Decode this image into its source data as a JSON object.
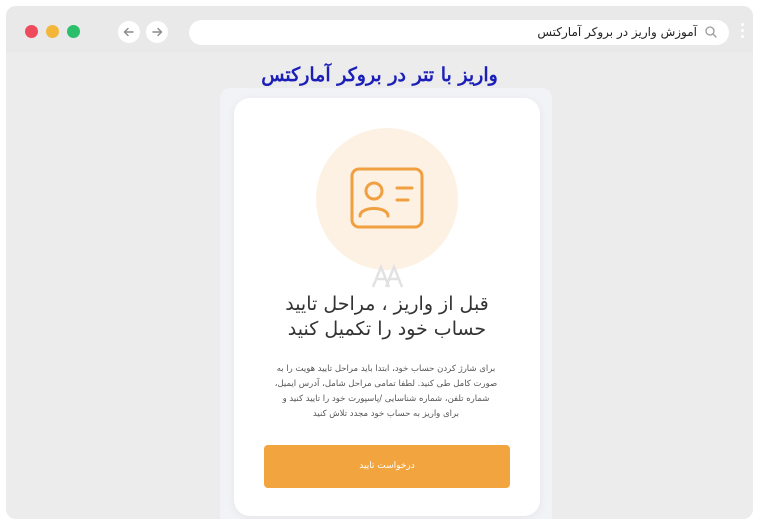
{
  "browser": {
    "address_text": "آموزش واریز در بروکر آمارکتس",
    "icons": {
      "back": "arrow-left-icon",
      "forward": "arrow-right-icon",
      "search": "search-icon",
      "menu": "more-vertical-icon"
    },
    "traffic_lights": [
      "#ee4b5d",
      "#f4b63a",
      "#2bbf6c"
    ]
  },
  "page": {
    "heading": "واریز با تتر در بروکر آمارکتس"
  },
  "card": {
    "icon": "id-card-icon",
    "accent_color": "#f2a53e",
    "title_line1": "قبل از واریز ، مراحل تایید",
    "title_line2": "حساب خود را تکمیل کنید",
    "desc_line1": "برای شارژ کردن حساب خود، ابتدا باید مراحل تایید هویت را به",
    "desc_line2": "صورت کامل طی کنید. لطفا تمامی مراحل شامل، آدرس ایمیل،",
    "desc_line3": "شماره تلفن، شماره شناسایی /پاسپورت خود را تایید کنید و",
    "desc_line4": "برای واریز به حساب خود مجدد تلاش کنید",
    "button_label": "درخواست تایید"
  }
}
